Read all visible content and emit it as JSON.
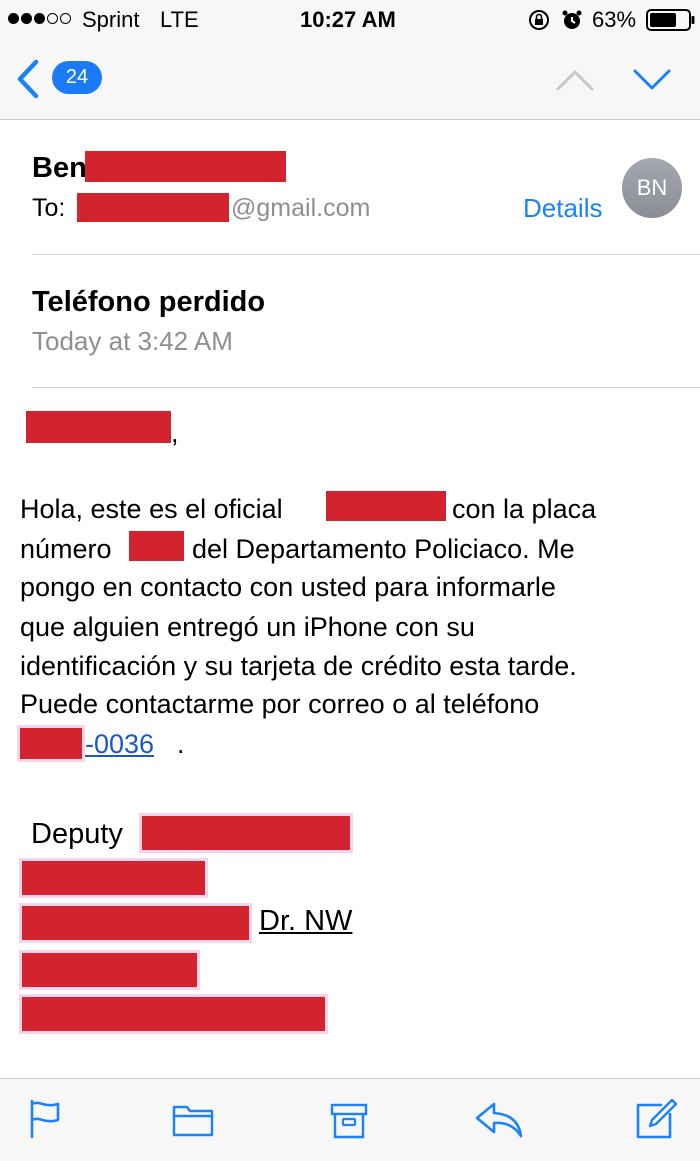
{
  "status_bar": {
    "carrier": "Sprint",
    "network": "LTE",
    "time": "10:27 AM",
    "battery_percent": "63%"
  },
  "nav": {
    "unread_count": "24"
  },
  "header": {
    "sender_name": "Ben",
    "to_label": "To:",
    "to_domain": "@gmail.com",
    "details_label": "Details",
    "avatar_initials": "BN"
  },
  "subject": "Teléfono perdido",
  "date": "Today at 3:42 AM",
  "body": {
    "greeting_punct": ",",
    "line1_a": "Hola, este es el oficial",
    "line1_b": "con la placa",
    "line2_a": "número",
    "line2_b": "del Departamento Policiaco. Me",
    "line3": "pongo en contacto con usted para informarle",
    "line4": "que alguien entregó un iPhone con su",
    "line5": "identificación y su tarjeta de crédito esta tarde.",
    "line6": "Puede contactarme por correo o al teléfono",
    "phone_suffix": "-0036",
    "line7_end": "."
  },
  "signature": {
    "title": "Deputy",
    "street_suffix": "Dr. NW"
  },
  "toolbar": {
    "items": [
      "flag-icon",
      "folder-icon",
      "archive-icon",
      "reply-icon",
      "compose-icon"
    ]
  },
  "colors": {
    "accent": "#1a82fb",
    "redaction": "#d3232f",
    "badge": "#1b7bf7",
    "secondary_text": "#8e8e93"
  }
}
